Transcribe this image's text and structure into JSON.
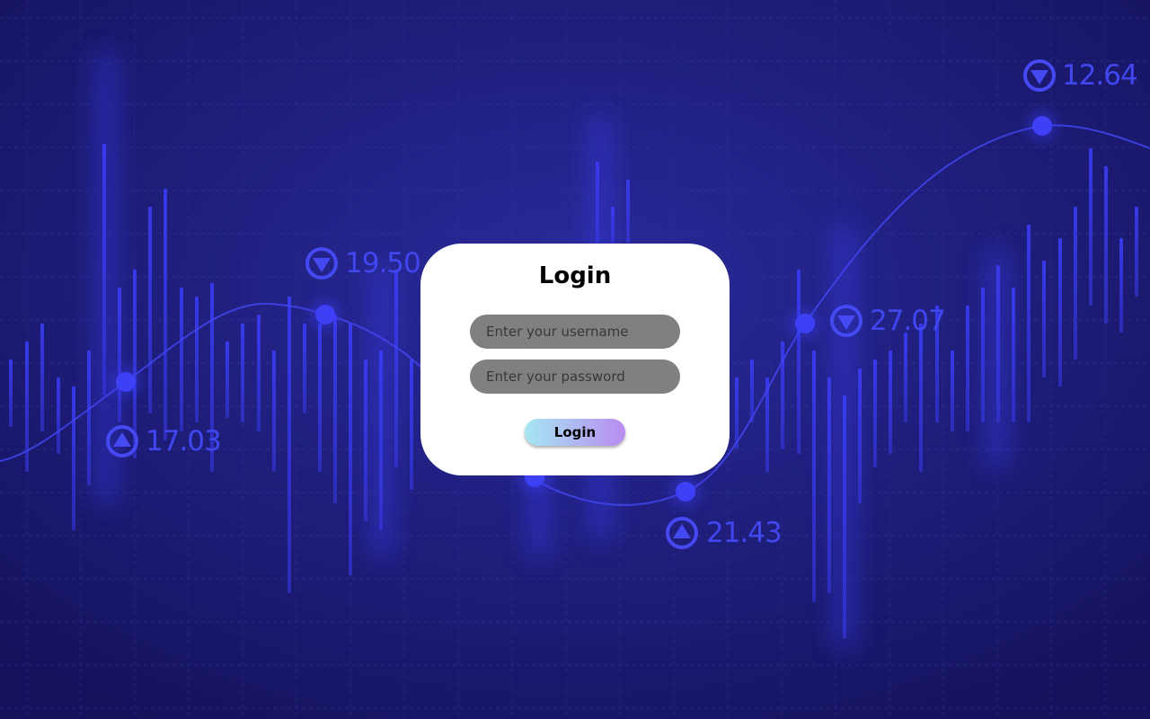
{
  "background": {
    "base_color": "#1c1a78",
    "accent_color": "#3a3cf5",
    "markers": [
      {
        "value": "17.03",
        "direction": "up"
      },
      {
        "value": "19.50",
        "direction": "down"
      },
      {
        "value": "21.43",
        "direction": "up"
      },
      {
        "value": "27.07",
        "direction": "down"
      },
      {
        "value": "12.64",
        "direction": "down"
      }
    ]
  },
  "login": {
    "title": "Login",
    "username_placeholder": "Enter your username",
    "password_placeholder": "Enter your password",
    "submit_label": "Login",
    "button_gradient": [
      "#a6e6f2",
      "#b88cf0"
    ]
  }
}
